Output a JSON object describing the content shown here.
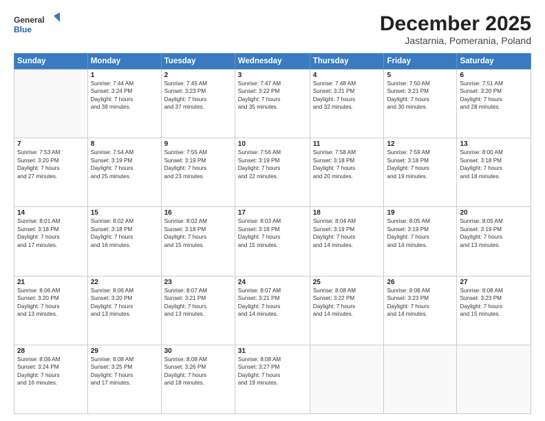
{
  "header": {
    "logo_line1": "General",
    "logo_line2": "Blue",
    "month": "December 2025",
    "location": "Jastarnia, Pomerania, Poland"
  },
  "days_of_week": [
    "Sunday",
    "Monday",
    "Tuesday",
    "Wednesday",
    "Thursday",
    "Friday",
    "Saturday"
  ],
  "weeks": [
    [
      {
        "num": "",
        "info": ""
      },
      {
        "num": "1",
        "info": "Sunrise: 7:44 AM\nSunset: 3:24 PM\nDaylight: 7 hours\nand 39 minutes."
      },
      {
        "num": "2",
        "info": "Sunrise: 7:45 AM\nSunset: 3:23 PM\nDaylight: 7 hours\nand 37 minutes."
      },
      {
        "num": "3",
        "info": "Sunrise: 7:47 AM\nSunset: 3:22 PM\nDaylight: 7 hours\nand 35 minutes."
      },
      {
        "num": "4",
        "info": "Sunrise: 7:48 AM\nSunset: 3:21 PM\nDaylight: 7 hours\nand 32 minutes."
      },
      {
        "num": "5",
        "info": "Sunrise: 7:50 AM\nSunset: 3:21 PM\nDaylight: 7 hours\nand 30 minutes."
      },
      {
        "num": "6",
        "info": "Sunrise: 7:51 AM\nSunset: 3:20 PM\nDaylight: 7 hours\nand 28 minutes."
      }
    ],
    [
      {
        "num": "7",
        "info": "Sunrise: 7:53 AM\nSunset: 3:20 PM\nDaylight: 7 hours\nand 27 minutes."
      },
      {
        "num": "8",
        "info": "Sunrise: 7:54 AM\nSunset: 3:19 PM\nDaylight: 7 hours\nand 25 minutes."
      },
      {
        "num": "9",
        "info": "Sunrise: 7:55 AM\nSunset: 3:19 PM\nDaylight: 7 hours\nand 23 minutes."
      },
      {
        "num": "10",
        "info": "Sunrise: 7:56 AM\nSunset: 3:19 PM\nDaylight: 7 hours\nand 22 minutes."
      },
      {
        "num": "11",
        "info": "Sunrise: 7:58 AM\nSunset: 3:18 PM\nDaylight: 7 hours\nand 20 minutes."
      },
      {
        "num": "12",
        "info": "Sunrise: 7:59 AM\nSunset: 3:18 PM\nDaylight: 7 hours\nand 19 minutes."
      },
      {
        "num": "13",
        "info": "Sunrise: 8:00 AM\nSunset: 3:18 PM\nDaylight: 7 hours\nand 18 minutes."
      }
    ],
    [
      {
        "num": "14",
        "info": "Sunrise: 8:01 AM\nSunset: 3:18 PM\nDaylight: 7 hours\nand 17 minutes."
      },
      {
        "num": "15",
        "info": "Sunrise: 8:02 AM\nSunset: 3:18 PM\nDaylight: 7 hours\nand 16 minutes."
      },
      {
        "num": "16",
        "info": "Sunrise: 8:02 AM\nSunset: 3:18 PM\nDaylight: 7 hours\nand 15 minutes."
      },
      {
        "num": "17",
        "info": "Sunrise: 8:03 AM\nSunset: 3:18 PM\nDaylight: 7 hours\nand 15 minutes."
      },
      {
        "num": "18",
        "info": "Sunrise: 8:04 AM\nSunset: 3:19 PM\nDaylight: 7 hours\nand 14 minutes."
      },
      {
        "num": "19",
        "info": "Sunrise: 8:05 AM\nSunset: 3:19 PM\nDaylight: 7 hours\nand 14 minutes."
      },
      {
        "num": "20",
        "info": "Sunrise: 8:05 AM\nSunset: 3:19 PM\nDaylight: 7 hours\nand 13 minutes."
      }
    ],
    [
      {
        "num": "21",
        "info": "Sunrise: 8:06 AM\nSunset: 3:20 PM\nDaylight: 7 hours\nand 13 minutes."
      },
      {
        "num": "22",
        "info": "Sunrise: 8:06 AM\nSunset: 3:20 PM\nDaylight: 7 hours\nand 13 minutes."
      },
      {
        "num": "23",
        "info": "Sunrise: 8:07 AM\nSunset: 3:21 PM\nDaylight: 7 hours\nand 13 minutes."
      },
      {
        "num": "24",
        "info": "Sunrise: 8:07 AM\nSunset: 3:21 PM\nDaylight: 7 hours\nand 14 minutes."
      },
      {
        "num": "25",
        "info": "Sunrise: 8:08 AM\nSunset: 3:22 PM\nDaylight: 7 hours\nand 14 minutes."
      },
      {
        "num": "26",
        "info": "Sunrise: 8:08 AM\nSunset: 3:23 PM\nDaylight: 7 hours\nand 14 minutes."
      },
      {
        "num": "27",
        "info": "Sunrise: 8:08 AM\nSunset: 3:23 PM\nDaylight: 7 hours\nand 15 minutes."
      }
    ],
    [
      {
        "num": "28",
        "info": "Sunrise: 8:08 AM\nSunset: 3:24 PM\nDaylight: 7 hours\nand 16 minutes."
      },
      {
        "num": "29",
        "info": "Sunrise: 8:08 AM\nSunset: 3:25 PM\nDaylight: 7 hours\nand 17 minutes."
      },
      {
        "num": "30",
        "info": "Sunrise: 8:08 AM\nSunset: 3:26 PM\nDaylight: 7 hours\nand 18 minutes."
      },
      {
        "num": "31",
        "info": "Sunrise: 8:08 AM\nSunset: 3:27 PM\nDaylight: 7 hours\nand 19 minutes."
      },
      {
        "num": "",
        "info": ""
      },
      {
        "num": "",
        "info": ""
      },
      {
        "num": "",
        "info": ""
      }
    ]
  ]
}
